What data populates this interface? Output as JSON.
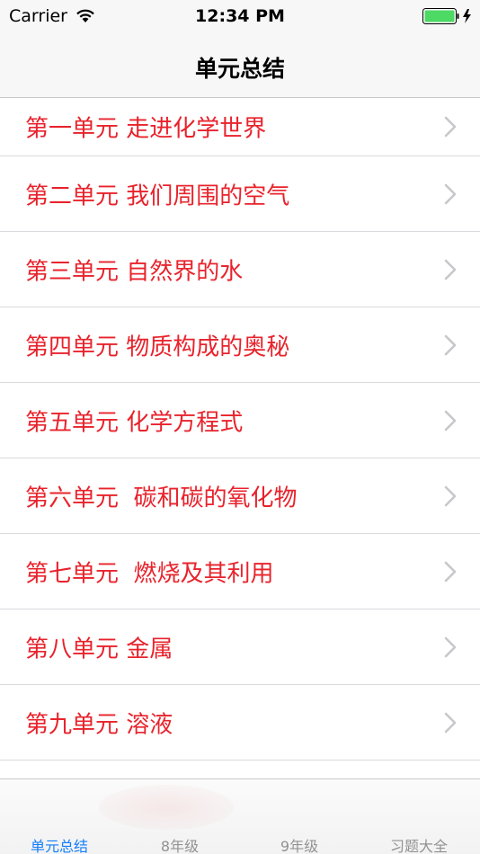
{
  "status_bar": {
    "carrier": "Carrier",
    "time": "12:34 PM",
    "battery_color": "#4cd964"
  },
  "nav": {
    "title": "单元总结"
  },
  "list": {
    "label_color": "#e8232c",
    "items": [
      {
        "label": "第一单元 走进化学世界",
        "icon": "chevron-right-icon"
      },
      {
        "label": "第二单元 我们周围的空气",
        "icon": "chevron-right-icon"
      },
      {
        "label": "第三单元 自然界的水",
        "icon": "chevron-right-icon"
      },
      {
        "label": "第四单元 物质构成的奥秘",
        "icon": "chevron-right-icon"
      },
      {
        "label": "第五单元 化学方程式",
        "icon": "chevron-right-icon"
      },
      {
        "label": "第六单元  碳和碳的氧化物",
        "icon": "chevron-right-icon"
      },
      {
        "label": "第七单元  燃烧及其利用",
        "icon": "chevron-right-icon"
      },
      {
        "label": "第八单元 金属",
        "icon": "chevron-right-icon"
      },
      {
        "label": "第九单元 溶液",
        "icon": "chevron-right-icon"
      }
    ]
  },
  "tab_bar": {
    "active_color": "#147efb",
    "tabs": [
      {
        "label": "单元总结",
        "active": true
      },
      {
        "label": "8年级",
        "active": false
      },
      {
        "label": "9年级",
        "active": false
      },
      {
        "label": "习题大全",
        "active": false
      }
    ]
  }
}
